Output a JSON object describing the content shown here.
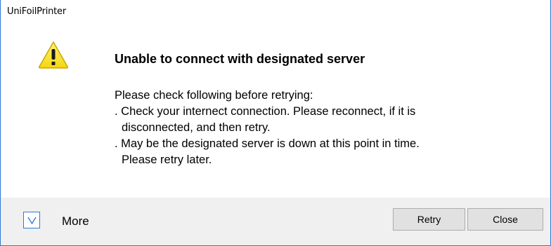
{
  "window": {
    "title": "UniFoilPrinter"
  },
  "icon": {
    "name": "warning-icon",
    "color": "#f5d60e"
  },
  "message": {
    "heading": "Unable to connect with designated server",
    "lines": [
      "Please check following before retrying:",
      ". Check your internect connection. Please reconnect, if it is",
      "disconnected, and then retry.",
      ". May be the designated server is down at this point in time.",
      "Please retry later."
    ]
  },
  "footer": {
    "expander_icon": "chevron-down-icon",
    "more_label": "More",
    "retry_label": "Retry",
    "close_label": "Close"
  },
  "colors": {
    "accent": "#2b79d8",
    "footer_bg": "#f0f0f0",
    "button_bg": "#e1e1e1"
  }
}
